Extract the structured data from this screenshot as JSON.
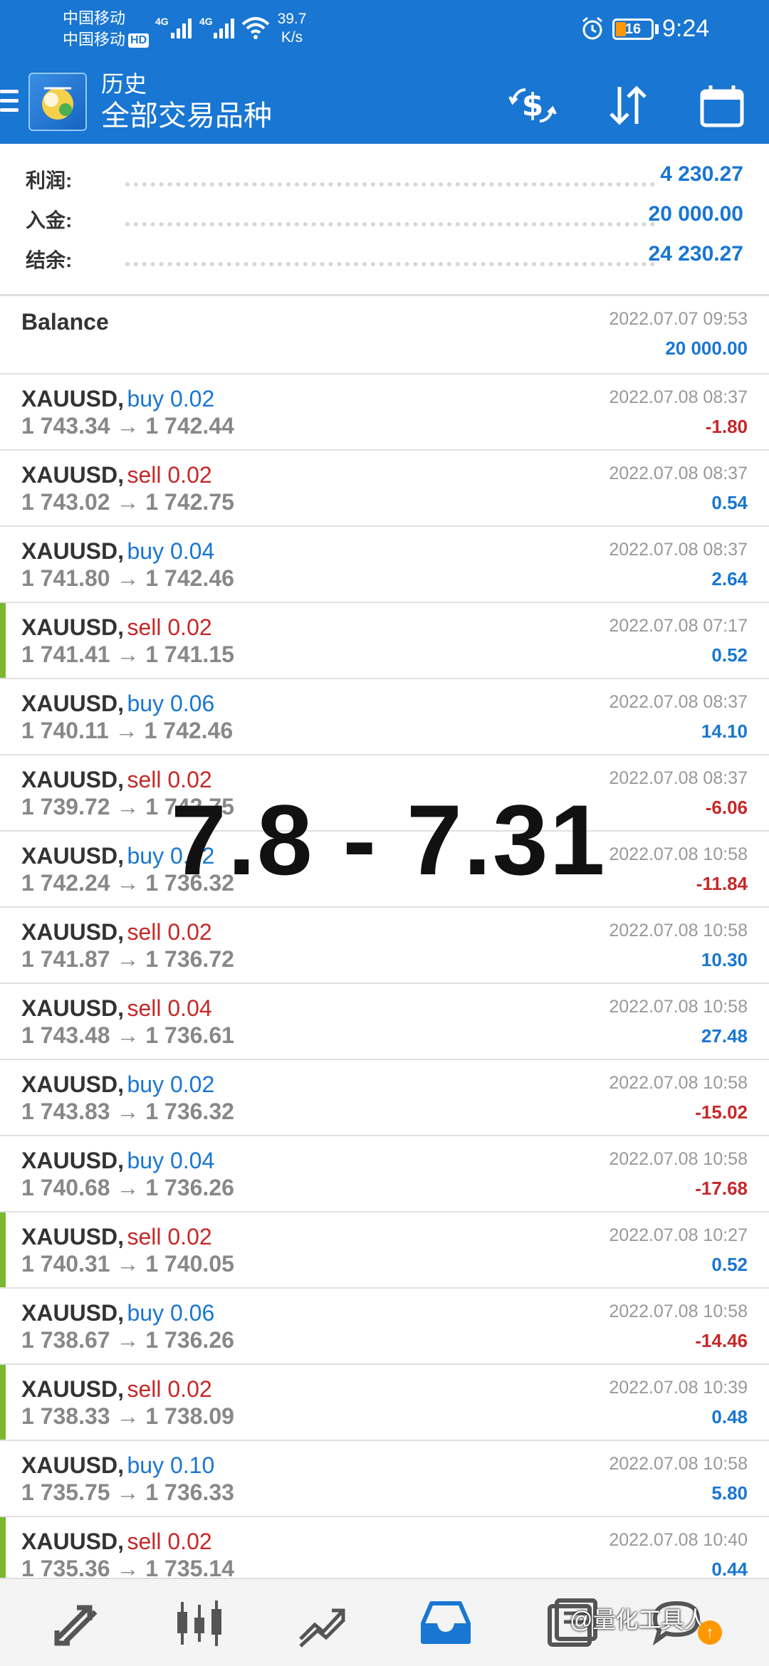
{
  "status_bar": {
    "carrier1": "中国移动",
    "carrier2": "中国移动",
    "hd_badge": "HD",
    "signal1_label": "4G",
    "signal2_label": "4G",
    "net_speed_value": "39.7",
    "net_speed_unit": "K/s",
    "battery_level": "16",
    "time": "9:24",
    "icons": [
      "signal-icon",
      "wifi-icon",
      "alarm-icon",
      "battery-icon"
    ]
  },
  "app_bar": {
    "title": "历史",
    "subtitle": "全部交易品种",
    "icons": [
      "menu-icon",
      "app-logo",
      "currency-exchange-icon",
      "sort-icon",
      "calendar-icon"
    ],
    "accent_color": "#1976d2"
  },
  "summary": {
    "rows": [
      {
        "label": "利润:",
        "value": "4 230.27"
      },
      {
        "label": "入金:",
        "value": "20 000.00"
      },
      {
        "label": "结余:",
        "value": "24 230.27"
      }
    ]
  },
  "balance_entry": {
    "label": "Balance",
    "time": "2022.07.07 09:53",
    "amount": "20 000.00"
  },
  "deals": [
    {
      "symbol": "XAUUSD,",
      "side": "buy",
      "side_text": "buy 0.02",
      "prices": "1 743.34 → 1 742.44",
      "time": "2022.07.08 08:37",
      "profit": "-1.80",
      "marked": false
    },
    {
      "symbol": "XAUUSD,",
      "side": "sell",
      "side_text": "sell 0.02",
      "prices": "1 743.02 → 1 742.75",
      "time": "2022.07.08 08:37",
      "profit": "0.54",
      "marked": false
    },
    {
      "symbol": "XAUUSD,",
      "side": "buy",
      "side_text": "buy 0.04",
      "prices": "1 741.80 → 1 742.46",
      "time": "2022.07.08 08:37",
      "profit": "2.64",
      "marked": false
    },
    {
      "symbol": "XAUUSD,",
      "side": "sell",
      "side_text": "sell 0.02",
      "prices": "1 741.41 → 1 741.15",
      "time": "2022.07.08 07:17",
      "profit": "0.52",
      "marked": true
    },
    {
      "symbol": "XAUUSD,",
      "side": "buy",
      "side_text": "buy 0.06",
      "prices": "1 740.11 → 1 742.46",
      "time": "2022.07.08 08:37",
      "profit": "14.10",
      "marked": false
    },
    {
      "symbol": "XAUUSD,",
      "side": "sell",
      "side_text": "sell 0.02",
      "prices": "1 739.72 → 1 742.75",
      "time": "2022.07.08 08:37",
      "profit": "-6.06",
      "marked": false
    },
    {
      "symbol": "XAUUSD,",
      "side": "buy",
      "side_text": "buy 0.02",
      "prices": "1 742.24 → 1 736.32",
      "time": "2022.07.08 10:58",
      "profit": "-11.84",
      "marked": false
    },
    {
      "symbol": "XAUUSD,",
      "side": "sell",
      "side_text": "sell 0.02",
      "prices": "1 741.87 → 1 736.72",
      "time": "2022.07.08 10:58",
      "profit": "10.30",
      "marked": false
    },
    {
      "symbol": "XAUUSD,",
      "side": "sell",
      "side_text": "sell 0.04",
      "prices": "1 743.48 → 1 736.61",
      "time": "2022.07.08 10:58",
      "profit": "27.48",
      "marked": false
    },
    {
      "symbol": "XAUUSD,",
      "side": "buy",
      "side_text": "buy 0.02",
      "prices": "1 743.83 → 1 736.32",
      "time": "2022.07.08 10:58",
      "profit": "-15.02",
      "marked": false
    },
    {
      "symbol": "XAUUSD,",
      "side": "buy",
      "side_text": "buy 0.04",
      "prices": "1 740.68 → 1 736.26",
      "time": "2022.07.08 10:58",
      "profit": "-17.68",
      "marked": false
    },
    {
      "symbol": "XAUUSD,",
      "side": "sell",
      "side_text": "sell 0.02",
      "prices": "1 740.31 → 1 740.05",
      "time": "2022.07.08 10:27",
      "profit": "0.52",
      "marked": true
    },
    {
      "symbol": "XAUUSD,",
      "side": "buy",
      "side_text": "buy 0.06",
      "prices": "1 738.67 → 1 736.26",
      "time": "2022.07.08 10:58",
      "profit": "-14.46",
      "marked": false
    },
    {
      "symbol": "XAUUSD,",
      "side": "sell",
      "side_text": "sell 0.02",
      "prices": "1 738.33 → 1 738.09",
      "time": "2022.07.08 10:39",
      "profit": "0.48",
      "marked": true
    },
    {
      "symbol": "XAUUSD,",
      "side": "buy",
      "side_text": "buy 0.10",
      "prices": "1 735.75 → 1 736.33",
      "time": "2022.07.08 10:58",
      "profit": "5.80",
      "marked": false
    },
    {
      "symbol": "XAUUSD,",
      "side": "sell",
      "side_text": "sell 0.02",
      "prices": "1 735.36 → 1 735.14",
      "time": "2022.07.08 10:40",
      "profit": "0.44",
      "marked": true
    }
  ],
  "overlay": {
    "text": "7.8 - 7.31"
  },
  "bottom_nav": {
    "items": [
      "quotes-icon",
      "chart-candles-icon",
      "trade-icon",
      "history-icon",
      "messages-icon",
      "chat-icon"
    ],
    "active": "history-icon"
  },
  "watermark": {
    "text": "@量化工具人"
  },
  "notification": {
    "badge": "↑"
  },
  "colors": {
    "buy": "#1976d2",
    "sell": "#c62828",
    "marker": "#7cb82f"
  }
}
